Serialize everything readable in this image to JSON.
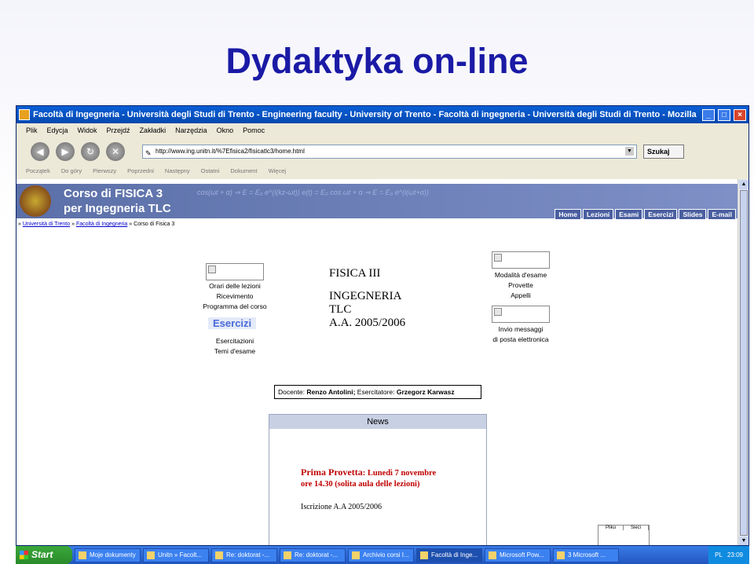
{
  "slide": {
    "title": "Dydaktyka on-line"
  },
  "window": {
    "title": "Facoltà di Ingegneria - Università degli Studi di Trento - Engineering faculty - University of Trento - Facoltà di ingegneria - Università degli Studi di Trento - Mozilla",
    "minimize": "_",
    "maximize": "□",
    "close": "×"
  },
  "menu": [
    "Plik",
    "Edycja",
    "Widok",
    "Przejdź",
    "Zakładki",
    "Narzędzia",
    "Okno",
    "Pomoc"
  ],
  "nav": {
    "back": "◀",
    "forward": "▶",
    "reload": "↻",
    "stop": "✕"
  },
  "address": {
    "url": "http://www.ing.unitn.it/%7Efisica2/fisicatlc3/home.html",
    "search": "Szukaj"
  },
  "sidebar_toolbar": [
    "Początek",
    "Do góry",
    "Pierwszy",
    "Poprzedni",
    "Następny",
    "Ostatni",
    "Dokument",
    "Więcej"
  ],
  "banner": {
    "course_line1": "Corso di FISICA 3",
    "course_line2": "per Ingegneria TLC",
    "formula": "cos(ωt + α)  ⇒  E = E₀ e^(i(kz-ωt))  e(t) = E₀ cos ωt + α   ⇒  E = E₀ e^(i(ωt+α))"
  },
  "tabs": [
    "Home",
    "Lezioni",
    "Esami",
    "Esercizi",
    "Slides",
    "E-mail"
  ],
  "breadcrumb": {
    "link1": "Università di Trento",
    "link2": "Facoltà di Ingegneria",
    "current": "Corso di Fisica 3"
  },
  "left_links": [
    "Orari delle lezioni",
    "Ricevimento",
    "Programma del corso",
    "Esercitazioni",
    "Temi d'esame"
  ],
  "esercizi_label": "Esercizi",
  "center": {
    "line1": "FISICA III",
    "line2": "INGEGNERIA",
    "line3": "TLC",
    "line4": "A.A. 2005/2006"
  },
  "right_links": [
    "Modalità d'esame",
    "Provette",
    "Appelli",
    "Invio messaggi",
    "di posta elettronica"
  ],
  "docente": {
    "label": "Docente:",
    "name": "Renzo Antolini;",
    "esercitatore_label": "Esercitatore:",
    "esercitatore": "Grzegorz Karwasz"
  },
  "news": {
    "header": "News",
    "provetta": "Prima Provetta",
    "provetta_rest": ": Lunedì 7 novembre",
    "provetta_line2": "ore 14.30  (solita aula delle lezioni)",
    "iscrizione": "Iscrizione A.A 2005/2006"
  },
  "mini_panel": {
    "col1": "Pliku",
    "col2": "Sieci"
  },
  "taskbar": {
    "start": "Start",
    "tasks": [
      "Moje dokumenty",
      "Unitn » Facolt...",
      "Re: doktorat -...",
      "Re: doktorat -...",
      "Archivio corsi I...",
      "Facoltà di Inge...",
      "Microsoft Pow...",
      "3 Microsoft ..."
    ],
    "lang": "PL",
    "clock": "23:09"
  }
}
